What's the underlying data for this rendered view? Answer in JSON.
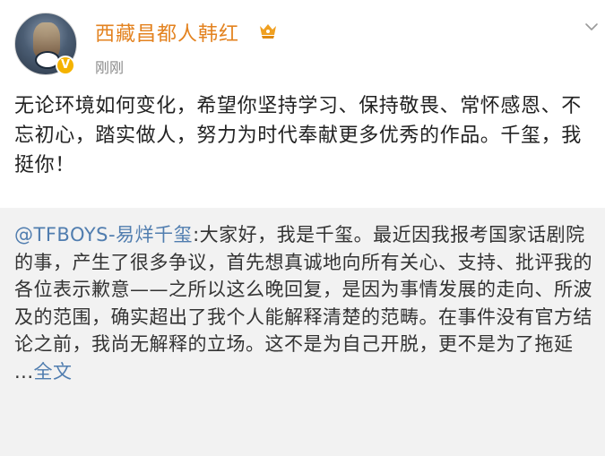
{
  "post": {
    "author": {
      "name": "西藏昌都人韩红",
      "avatar_icon": "avatar-portrait-icon",
      "verified_icon": "verified-v-icon",
      "badge_icon": "fan-badge-icon"
    },
    "timestamp": "刚刚",
    "more_icon": "chevron-down-icon",
    "content": "无论环境如何变化，希望你坚持学习、保持敬畏、常怀感恩、不忘初心，踏实做人，努力为时代奉献更多优秀的作品。千玺，我挺你！"
  },
  "repost": {
    "mention": "@TFBOYS-易烊千玺",
    "body": ":大家好，我是千玺。最近因我报考国家话剧院的事，产生了很多争议，首先想真诚地向所有关心、支持、批评我的各位表示歉意——之所以这么晚回复，是因为事情发展的走向、所波及的范围，确实超出了我个人能解释清楚的范畴。在事件没有官方结论之前，我尚无解释的立场。这不是为自己开脱，更不是为了拖延 ...",
    "full_text_link": "全文"
  },
  "colors": {
    "username": "#e3821f",
    "link": "#507daf",
    "repost_bg": "#f2f2f2",
    "verified": "#f5b300"
  }
}
